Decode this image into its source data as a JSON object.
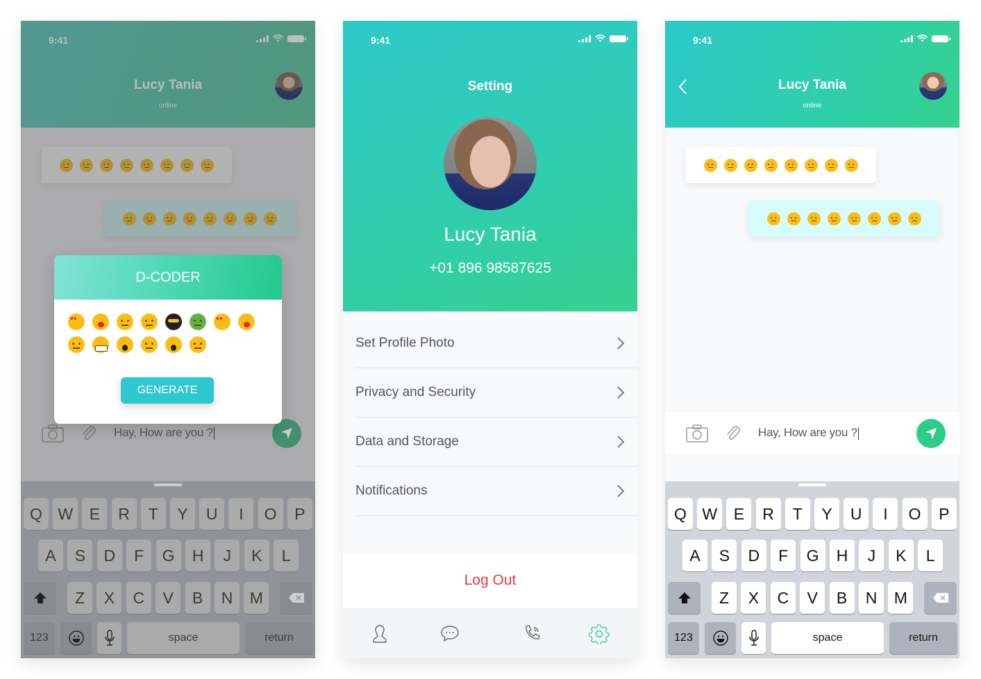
{
  "status_bar": {
    "time": "9:41"
  },
  "chat": {
    "contact_name": "Lucy Tania",
    "presence": "online",
    "incoming_emoji_count": 8,
    "outgoing_emoji_count": 8,
    "composer_text": "Hay, How are you ?",
    "icons": {
      "back": "chevron-left-icon",
      "camera": "camera-icon",
      "attach": "paperclip-icon",
      "send": "send-icon"
    }
  },
  "dialog": {
    "title": "D-CODER",
    "emojis": [
      "heart-eyes",
      "kiss",
      "angry",
      "nerd-glasses",
      "ninja",
      "green-face",
      "heart-eyes",
      "kiss",
      "angry",
      "grimace",
      "surprised",
      "whistle",
      "gasp",
      "annoyed"
    ],
    "generate_label": "GENERATE"
  },
  "keyboard": {
    "row1": [
      "Q",
      "W",
      "E",
      "R",
      "T",
      "Y",
      "U",
      "I",
      "O",
      "P"
    ],
    "row2": [
      "A",
      "S",
      "D",
      "F",
      "G",
      "H",
      "J",
      "K",
      "L"
    ],
    "row3": [
      "Z",
      "X",
      "C",
      "V",
      "B",
      "N",
      "M"
    ],
    "numbers_label": "123",
    "space_label": "space",
    "return_label": "return"
  },
  "settings": {
    "title": "Setting",
    "profile_name": "Lucy Tania",
    "phone": "+01 896 98587625",
    "items": [
      {
        "label": "Set Profile Photo"
      },
      {
        "label": "Privacy and Security"
      },
      {
        "label": "Data and Storage"
      },
      {
        "label": "Notifications"
      }
    ],
    "logout_label": "Log Out",
    "tabs": [
      {
        "icon": "contacts-icon",
        "active": false
      },
      {
        "icon": "chat-icon",
        "active": false
      },
      {
        "icon": "call-icon",
        "active": false
      },
      {
        "icon": "settings-gear-icon",
        "active": true
      }
    ],
    "accent_color": "#2ecc8a",
    "logout_color": "#e03b3b"
  }
}
